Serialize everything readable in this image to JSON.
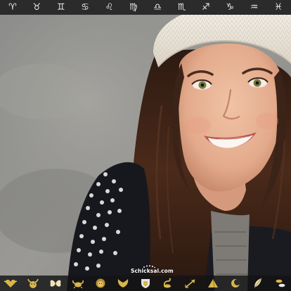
{
  "zodiac_bar": {
    "signs": [
      {
        "glyph": "♈",
        "icon": "aries-icon"
      },
      {
        "glyph": "♉",
        "icon": "taurus-icon"
      },
      {
        "glyph": "♊",
        "icon": "gemini-icon"
      },
      {
        "glyph": "♋",
        "icon": "cancer-icon"
      },
      {
        "glyph": "♌",
        "icon": "leo-icon"
      },
      {
        "glyph": "♍",
        "icon": "virgo-icon"
      },
      {
        "glyph": "♎",
        "icon": "libra-icon"
      },
      {
        "glyph": "♏",
        "icon": "scorpio-icon"
      },
      {
        "glyph": "♐",
        "icon": "sagittarius-icon"
      },
      {
        "glyph": "♑",
        "icon": "capricorn-icon"
      },
      {
        "glyph": "♒",
        "icon": "aquarius-icon"
      },
      {
        "glyph": "♓",
        "icon": "pisces-icon"
      }
    ]
  },
  "logo": {
    "text": "Schicksal.com"
  },
  "bottom_bar": {
    "icons": [
      "heart-wings-icon",
      "bull-icon",
      "butterfly-icon",
      "crab-icon",
      "lion-icon",
      "wings-icon",
      "crest-icon",
      "scorpion-icon",
      "arrow-icon",
      "pyramid-icon",
      "moon-icon",
      "feather-icon",
      "fish-icon"
    ]
  },
  "colors": {
    "top_bar": "#2b2b2b",
    "zodiac_glyph": "#ececec",
    "gold": "#d8b64a",
    "beanie": "#efe9df",
    "hair": "#3a2216",
    "skin": "#e7b296",
    "jacket": "#18191f"
  }
}
